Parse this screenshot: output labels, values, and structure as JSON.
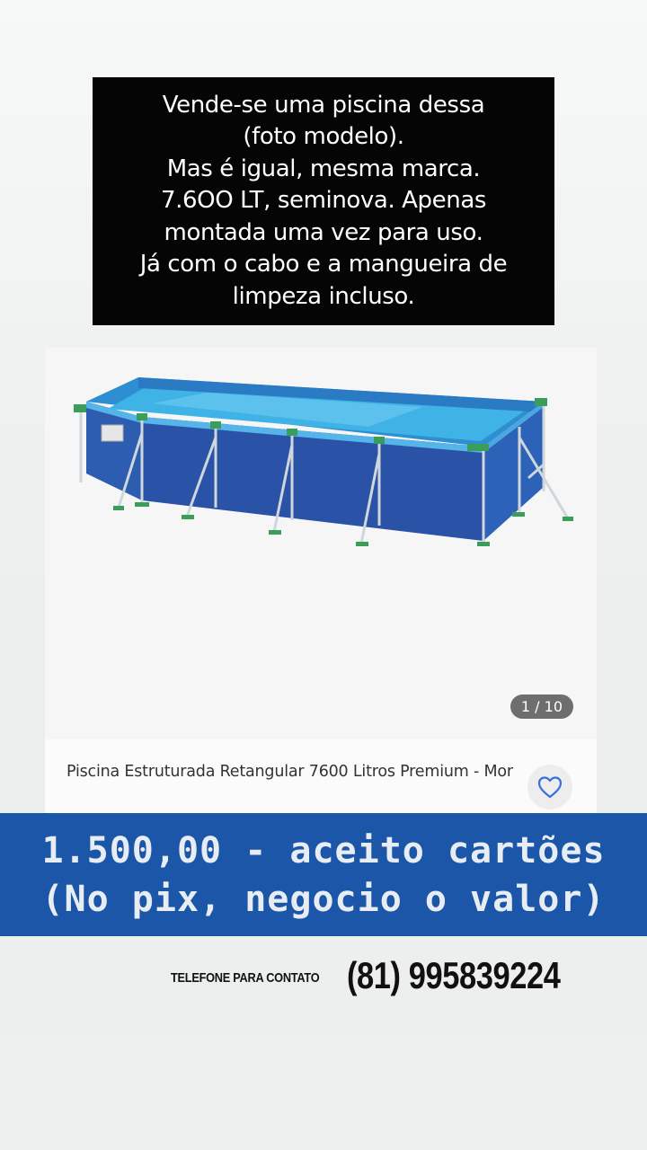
{
  "caption": {
    "lines": [
      "Vende-se uma piscina dessa",
      "(foto modelo).",
      "Mas é igual, mesma marca.",
      "7.6OO LT, seminova. Apenas",
      "montada uma vez para uso.",
      "Já com o cabo e a mangueira de",
      "limpeza incluso."
    ]
  },
  "product": {
    "image_counter": "1 / 10",
    "title": "Piscina Estruturada Retangular 7600 Litros Premium - Mor",
    "favorite_icon": "heart-outline-icon"
  },
  "price_banner": {
    "line1": "1.500,00 - aceito cartões",
    "line2": "(No pix, negocio o valor)"
  },
  "contact": {
    "label": "TELEFONE PARA CONTATO",
    "phone": "(81) 995839224"
  },
  "colors": {
    "banner_bg": "#1b56a8",
    "caption_bg": "#050505",
    "pool_blue": "#2b57ae",
    "pool_water": "#35a7e0",
    "heart_accent": "#3b6fd8"
  }
}
